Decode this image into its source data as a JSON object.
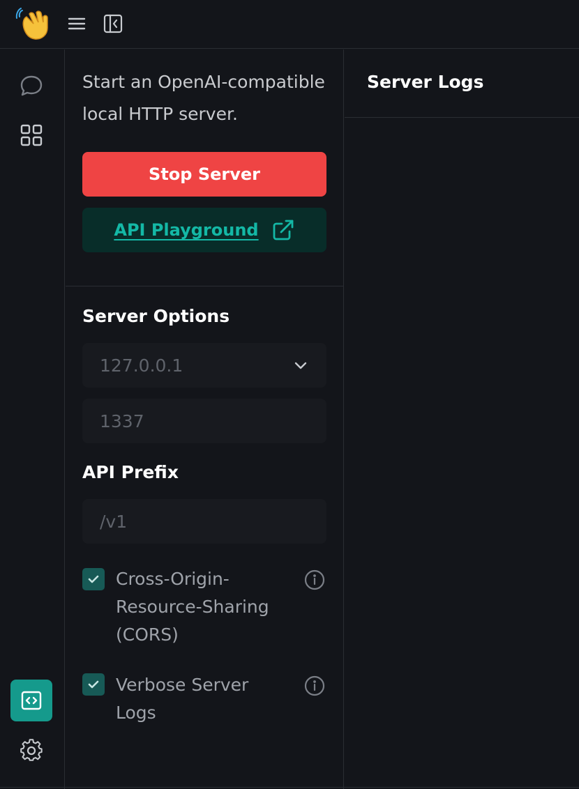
{
  "topbar": {
    "logo": "waving-hand-emoji",
    "menu_icon": "hamburger-menu-icon",
    "collapse_icon": "collapse-sidebar-icon"
  },
  "rail": {
    "items": [
      {
        "icon": "chat-bubble-icon"
      },
      {
        "icon": "grid-apps-icon"
      }
    ],
    "active_item": {
      "icon": "code-window-icon"
    },
    "settings_icon": "gear-icon"
  },
  "panel": {
    "intro": "Start an OpenAI-compatible local HTTP server.",
    "stop_button": "Stop Server",
    "playground_button": "API Playground",
    "server_options_title": "Server Options",
    "host": {
      "value": "127.0.0.1"
    },
    "port": {
      "value": "1337"
    },
    "api_prefix_title": "API Prefix",
    "api_prefix": {
      "value": "/v1"
    },
    "options": [
      {
        "label": "Cross-Origin-Resource-Sharing (CORS)",
        "checked": true
      },
      {
        "label": "Verbose Server Logs",
        "checked": true
      }
    ]
  },
  "logs": {
    "title": "Server Logs"
  },
  "colors": {
    "background": "#13151a",
    "danger": "#ef4444",
    "accent": "#14b8a6",
    "accent_active": "#159a8c"
  }
}
